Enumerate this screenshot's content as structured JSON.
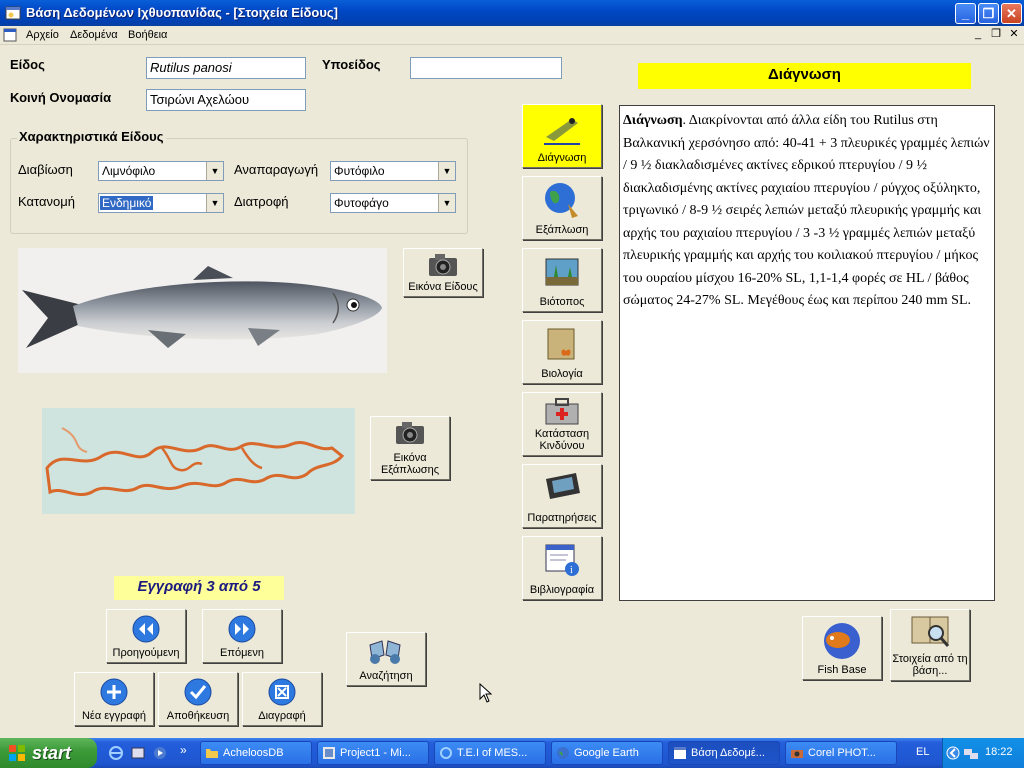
{
  "window": {
    "title": "Βάση Δεδομένων Ιχθυοπανίδας - [Στοιχεία Είδους]"
  },
  "menu": {
    "items": [
      "Αρχείο",
      "Δεδομένα",
      "Βοήθεια"
    ]
  },
  "form": {
    "species_label": "Είδος",
    "species_value": "Rutilus panosi",
    "subspecies_label": "Υποείδος",
    "subspecies_value": "",
    "common_name_label": "Κοινή Ονομασία",
    "common_name_value": "Τσιρώνι Αχελώου"
  },
  "characteristics": {
    "title": "Χαρακτηριστικά Είδους",
    "habitat_label": "Διαβίωση",
    "habitat_value": "Λιμνόφιλο",
    "reproduction_label": "Αναπαραγωγή",
    "reproduction_value": "Φυτόφιλο",
    "distribution_label": "Κατανομή",
    "distribution_value": "Ενδημικό",
    "diet_label": "Διατροφή",
    "diet_value": "Φυτοφάγο"
  },
  "buttons": {
    "species_image": "Εικόνα Είδους",
    "distribution_image": "Εικόνα Εξάπλωσης",
    "previous": "Προηγούμενη",
    "next": "Επόμενη",
    "new_record": "Νέα εγγραφή",
    "save": "Αποθήκευση",
    "delete": "Διαγραφή",
    "search": "Αναζήτηση",
    "fishbase": "Fish Base",
    "db_info": "Στοιχεία από τη βάση..."
  },
  "side_buttons": [
    "Διάγνωση",
    "Εξάπλωση",
    "Βιότοπος",
    "Βιολογία",
    "Κατάσταση Κινδύνου",
    "Παρατηρήσεις",
    "Βιβλιογραφία"
  ],
  "record_indicator": "Εγγραφή 3 από  5",
  "diagnosis": {
    "title": "Διάγνωση",
    "head": "Διάγνωση",
    "text": ". Διακρίνονται από άλλα είδη του Rutilus στη Βαλκανική χερσόνησο από: 40-41 + 3 πλευρικές γραμμές λεπιών / 9 ½ διακλαδισμένες ακτίνες εδρικού πτερυγίου / 9 ½ διακλαδισμένης ακτίνες ραχιαίου πτερυγίου / ρύγχος οξύληκτο, τριγωνικό / 8-9 ½ σειρές λεπιών μεταξύ πλευρικής γραμμής και αρχής του ραχιαίου πτερυγίου / 3 -3 ½ γραμμές λεπιών μεταξύ πλευρικής γραμμής και αρχής του κοιλιακού πτερυγίου / μήκος του ουραίου μίσχου 16-20% SL, 1,1-1,4 φορές σε HL / βάθος σώματος 24-27% SL. Μεγέθους έως και περίπου 240 mm SL."
  },
  "taskbar": {
    "start": "start",
    "tasks": [
      "AcheloosDB",
      "Project1 - Mi...",
      "T.E.I of MES...",
      "Google Earth",
      "Βάση Δεδομέ...",
      "Corel PHOT..."
    ],
    "lang": "EL",
    "clock": "18:22"
  },
  "colors": {
    "accent_yellow": "#FFFF00",
    "record_bg": "#FFFF99",
    "titlebar": "#0048C6",
    "face": "#ECE9D8"
  }
}
